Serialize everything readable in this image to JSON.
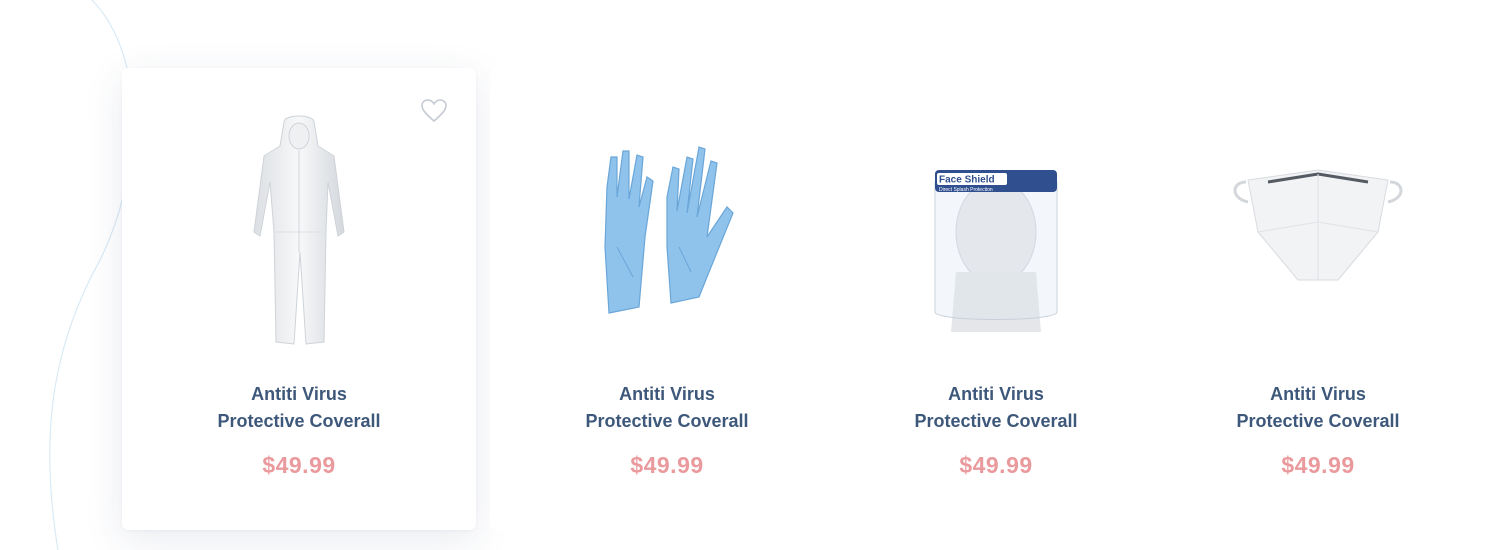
{
  "products": [
    {
      "icon": "coverall-icon",
      "name_line1": "Antiti Virus",
      "name_line2": "Protective Coverall",
      "price": "$49.99",
      "wishlist_icon": "heart-icon",
      "highlighted": true
    },
    {
      "icon": "gloves-icon",
      "name_line1": "Antiti Virus",
      "name_line2": "Protective Coverall",
      "price": "$49.99",
      "highlighted": false
    },
    {
      "icon": "face-shield-icon",
      "shield_label": "Face Shield",
      "shield_sublabel": "Direct Splash Protection",
      "name_line1": "Antiti Virus",
      "name_line2": "Protective Coverall",
      "price": "$49.99",
      "highlighted": false
    },
    {
      "icon": "face-mask-icon",
      "name_line1": "Antiti Virus",
      "name_line2": "Protective Coverall",
      "price": "$49.99",
      "highlighted": false
    }
  ],
  "colors": {
    "title": "#3d587a",
    "price": "#ea9a9d",
    "glove": "#8fc3ec",
    "shield_band": "#2f4f8f",
    "heart_outline": "#c5cad3"
  }
}
